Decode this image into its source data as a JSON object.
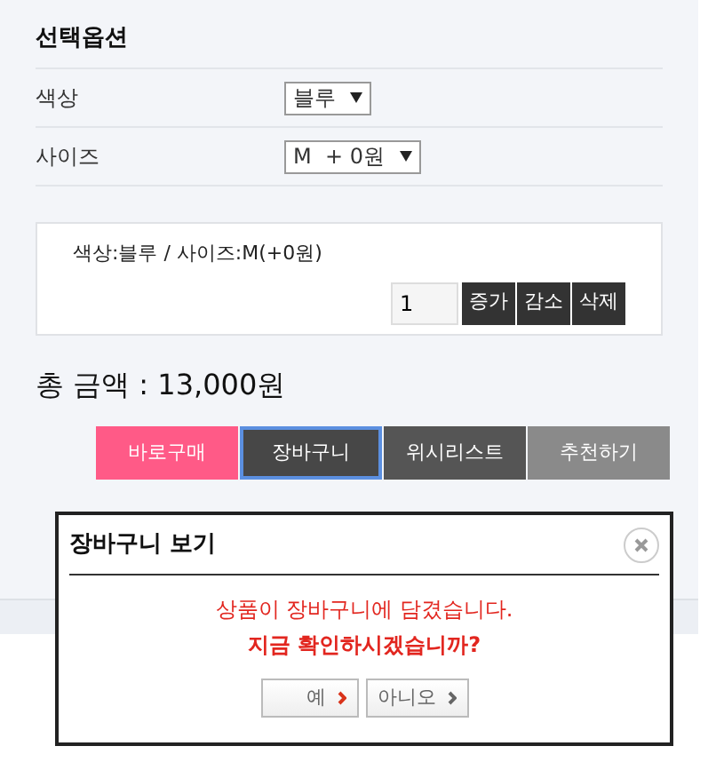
{
  "options": {
    "title": "선택옵션",
    "rows": [
      {
        "label": "색상",
        "value": "블루"
      },
      {
        "label": "사이즈",
        "value": "M  + 0원"
      }
    ]
  },
  "selection": {
    "text": "색상:블루 / 사이즈:M(+0원)",
    "quantity": "1",
    "buttons": [
      "증가",
      "감소",
      "삭제"
    ]
  },
  "total": "총 금액 : 13,000원",
  "actions": [
    {
      "label": "바로구매",
      "color": "#ff5a87",
      "selected": false
    },
    {
      "label": "장바구니",
      "color": "#474747",
      "selected": true
    },
    {
      "label": "위시리스트",
      "color": "#555555",
      "selected": false
    },
    {
      "label": "추천하기",
      "color": "#8a8a8a",
      "selected": false
    }
  ],
  "dialog": {
    "title": "장바구니 보기",
    "message": "상품이 장바구니에 담겼습니다.",
    "question": "지금 확인하시겠습니까?",
    "buttons": [
      {
        "label": "예",
        "kind": "primary"
      },
      {
        "label": "아니오",
        "kind": "secondary"
      }
    ]
  }
}
